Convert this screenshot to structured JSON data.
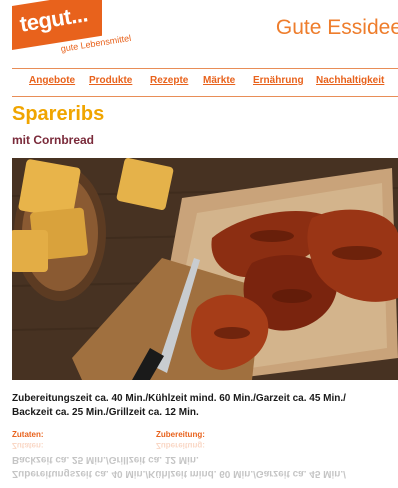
{
  "header": {
    "logo_word": "tegut...",
    "logo_tagline": "gute Lebensmittel",
    "slogan": "Gute Essidee"
  },
  "nav": {
    "items": [
      {
        "label": "Angebote"
      },
      {
        "label": "Produkte"
      },
      {
        "label": "Rezepte"
      },
      {
        "label": "Märkte"
      },
      {
        "label": "Ernährung"
      },
      {
        "label": "Nachhaltigkeit"
      }
    ]
  },
  "recipe": {
    "title": "Spareribs",
    "subtitle": "mit Cornbread",
    "times_line1": "Zubereitungszeit ca. 40 Min./Kühlzeit mind. 60 Min./Garzeit ca. 45 Min./",
    "times_line2": "Backzeit ca. 25 Min./Grillzeit ca. 12 Min.",
    "ingredients_label": "Zutaten:",
    "preparation_label": "Zubereitung:"
  },
  "colors": {
    "brand_orange": "#e8621c",
    "title_yellow": "#f0a500",
    "subtitle_maroon": "#7a2a3a"
  }
}
